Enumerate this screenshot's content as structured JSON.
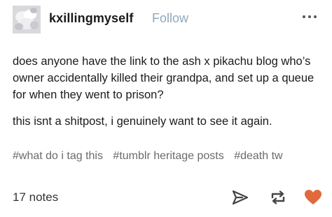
{
  "post": {
    "username": "kxillingmyself",
    "follow_label": "Follow",
    "body_paragraphs": [
      "does anyone have the link to the ash x pikachu blog who’s owner accidentally killed their grandpa, and set up a queue for when they went to prison?",
      "this isnt a shitpost, i genuinely want to see it again."
    ],
    "tags": [
      "#what do i tag this",
      "#tumblr heritage posts",
      "#death tw"
    ],
    "notes": "17 notes"
  },
  "icons": {
    "avatar": "avatar-image",
    "more": "more-options-icon",
    "share": "share-icon",
    "reblog": "reblog-icon",
    "like": "heart-icon"
  },
  "colors": {
    "follow": "#8fa8bd",
    "heart": "#e06a3b",
    "tags": "#6b6b6b"
  }
}
